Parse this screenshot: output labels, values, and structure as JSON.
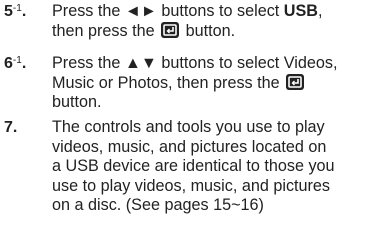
{
  "steps": [
    {
      "number": "5",
      "superscript": "-1",
      "suffix": ".",
      "text_before": "Press the ◄► buttons to select ",
      "bold": "USB",
      "text_after_bold": ",",
      "text_line2": "then press the",
      "text_after_icon": "button.",
      "icon": "enter-icon"
    },
    {
      "number": "6",
      "superscript": "-1",
      "suffix": ".",
      "text_before": "Press the ▲▼ buttons to select Videos,",
      "text_line2": "Music or Photos, then press the",
      "text_after_icon": "button.",
      "icon": "enter-icon"
    },
    {
      "number": "7.",
      "lines": [
        "The controls and tools you use to play",
        "videos, music, and pictures located on",
        "a USB device are identical to those you",
        "use to play videos, music, and pictures",
        "on a disc. (See pages 15~16)"
      ]
    }
  ]
}
